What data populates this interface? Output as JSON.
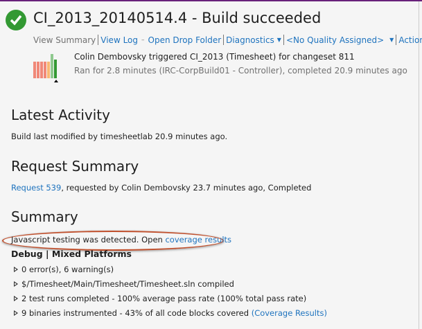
{
  "header": {
    "title": "CI_2013_20140514.4 - Build succeeded",
    "status_icon": "check-circle-icon",
    "status_color": "#339933"
  },
  "nav": {
    "view_summary": "View Summary",
    "view_log": "View Log",
    "open_drop_folder": "Open Drop Folder",
    "diagnostics": "Diagnostics",
    "quality": "<No Quality Assigned>",
    "actions": "Actions"
  },
  "build_info": {
    "trigger": "Colin Dembovsky triggered CI_2013 (Timesheet) for changeset 811",
    "run": "Ran for 2.8 minutes (IRC-CorpBuild01 - Controller), completed 20.9 minutes ago",
    "history": [
      {
        "status": "failed",
        "color": "#f08878"
      },
      {
        "status": "failed",
        "color": "#f08878"
      },
      {
        "status": "failed",
        "color": "#f08878"
      },
      {
        "status": "failed",
        "color": "#f08878"
      },
      {
        "status": "partial",
        "color": "#f9b872"
      },
      {
        "status": "succeeded",
        "color": "#8fc98f"
      },
      {
        "status": "succeeded",
        "color": "#339933"
      }
    ]
  },
  "latest_activity": {
    "heading": "Latest Activity",
    "text": "Build last modified by timesheetlab 20.9 minutes ago."
  },
  "request_summary": {
    "heading": "Request Summary",
    "link": "Request 539",
    "text": ", requested by Colin Dembovsky 23.7 minutes ago, Completed"
  },
  "summary": {
    "heading": "Summary",
    "js_text": "Javascript testing was detected. Open ",
    "js_link": "coverage results",
    "config": "Debug | Mixed Platforms",
    "items": [
      {
        "text": "0 error(s), 6 warning(s)"
      },
      {
        "text": "$/Timesheet/Main/Timesheet/Timesheet.sln compiled"
      },
      {
        "text": "2 test runs completed - 100% average pass rate (100% total pass rate)"
      },
      {
        "text": "9 binaries instrumented - 43% of all code blocks covered ",
        "link": "(Coverage Results)"
      }
    ]
  }
}
